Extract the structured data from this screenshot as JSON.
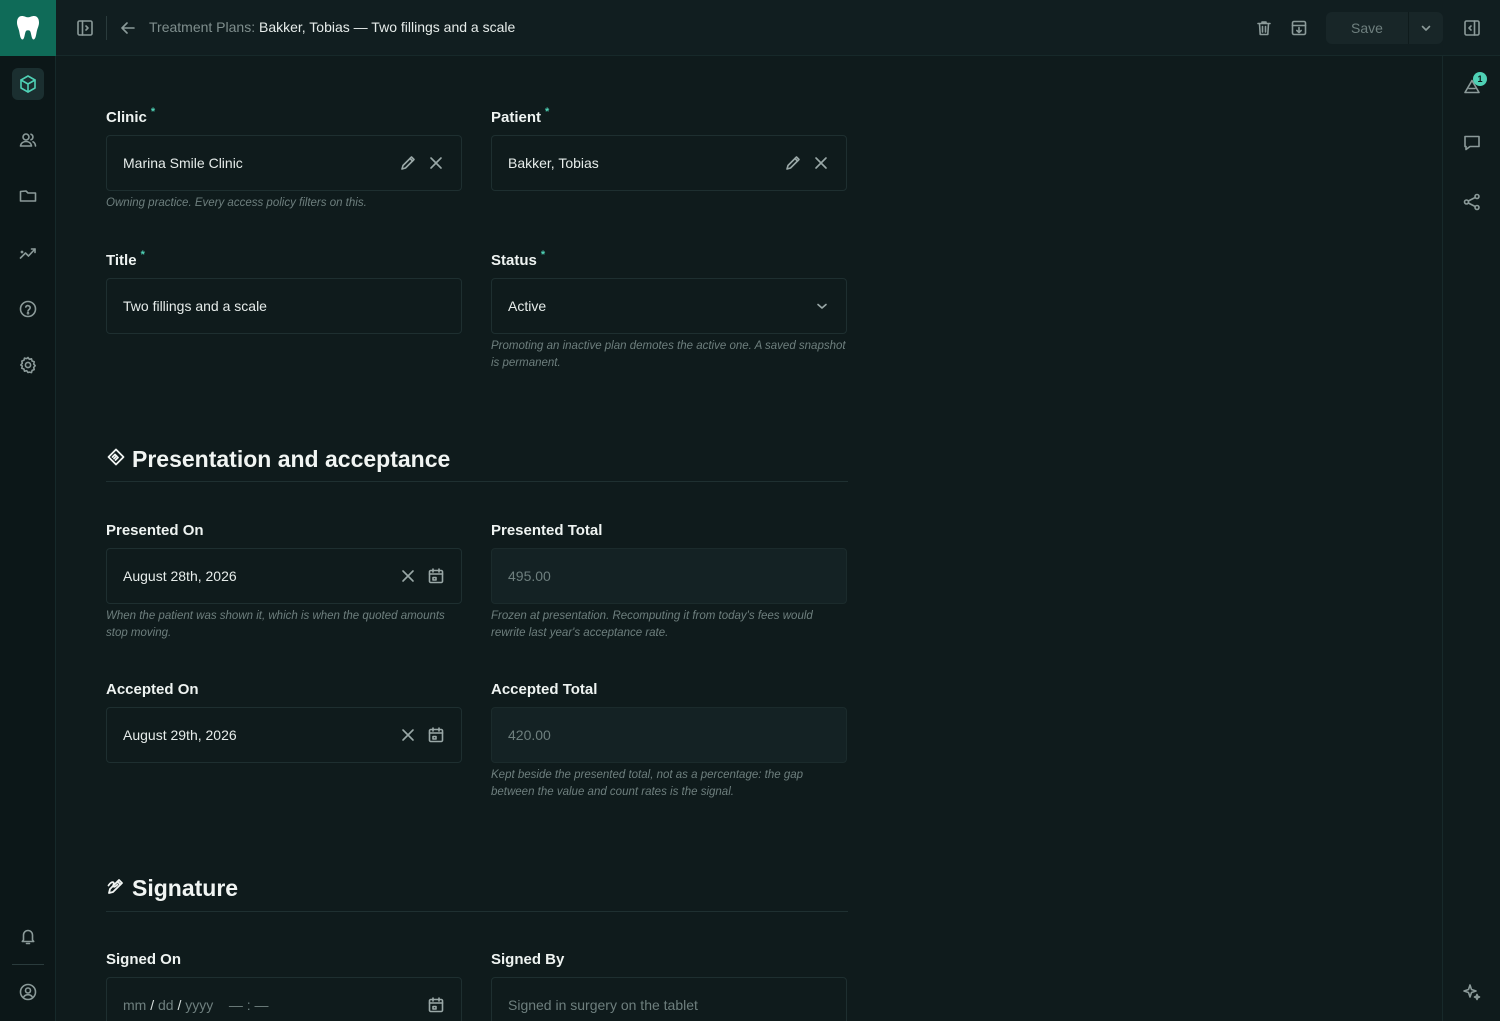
{
  "breadcrumb": {
    "section": "Treatment Plans:",
    "record": "Bakker, Tobias — Two fillings and a scale"
  },
  "toolbar": {
    "save_label": "Save"
  },
  "notifications": {
    "count": "1"
  },
  "form": {
    "clinic": {
      "label": "Clinic",
      "required": "*",
      "value": "Marina Smile Clinic",
      "hint": "Owning practice. Every access policy filters on this."
    },
    "patient": {
      "label": "Patient",
      "required": "*",
      "value": "Bakker, Tobias"
    },
    "title": {
      "label": "Title",
      "required": "*",
      "value": "Two fillings and a scale"
    },
    "status": {
      "label": "Status",
      "required": "*",
      "value": "Active",
      "hint": "Promoting an inactive plan demotes the active one. A saved snapshot is permanent."
    }
  },
  "presentation": {
    "title": "Presentation and acceptance",
    "presented_on": {
      "label": "Presented On",
      "value": "August 28th, 2026",
      "hint": "When the patient was shown it, which is when the quoted amounts stop moving."
    },
    "presented_total": {
      "label": "Presented Total",
      "value": "495.00",
      "hint": "Frozen at presentation. Recomputing it from today's fees would rewrite last year's acceptance rate."
    },
    "accepted_on": {
      "label": "Accepted On",
      "value": "August 29th, 2026"
    },
    "accepted_total": {
      "label": "Accepted Total",
      "value": "420.00",
      "hint": "Kept beside the presented total, not as a percentage: the gap between the value and count rates is the signal."
    }
  },
  "signature": {
    "title": "Signature",
    "signed_on": {
      "label": "Signed On",
      "mm": "mm",
      "dd": "dd",
      "yyyy": "yyyy",
      "slash": "/",
      "time": "— : —"
    },
    "signed_by": {
      "label": "Signed By",
      "placeholder": "Signed in surgery on the tablet"
    }
  },
  "icons": {
    "rail": [
      "tooth-logo-icon",
      "box-icon",
      "users-icon",
      "folder-icon",
      "analytics-icon",
      "help-icon",
      "settings-icon",
      "bell-icon",
      "account-icon"
    ],
    "right": [
      "activity-icon",
      "comment-icon",
      "share-icon",
      "sparkle-icon"
    ]
  },
  "colors": {
    "accent": "#4fd1b5",
    "brand": "#0f6b58",
    "background": "#0f1b1c"
  }
}
